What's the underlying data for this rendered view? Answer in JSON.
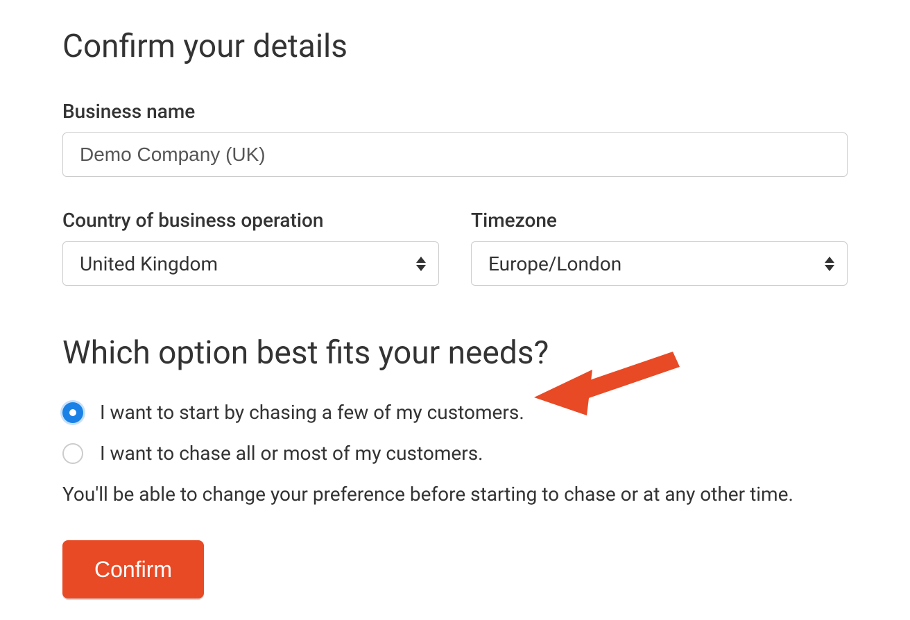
{
  "heading": "Confirm your details",
  "business": {
    "label": "Business name",
    "value": "Demo Company (UK)"
  },
  "country": {
    "label": "Country of business operation",
    "value": "United Kingdom"
  },
  "timezone": {
    "label": "Timezone",
    "value": "Europe/London"
  },
  "options": {
    "heading": "Which option best fits your needs?",
    "opt1": "I want to start by chasing a few of my customers.",
    "opt2": "I want to chase all or most of my customers.",
    "hint": "You'll be able to change your preference before starting to chase or at any other time."
  },
  "confirm": "Confirm",
  "annotation": {
    "arrow_color": "#e84a25"
  }
}
